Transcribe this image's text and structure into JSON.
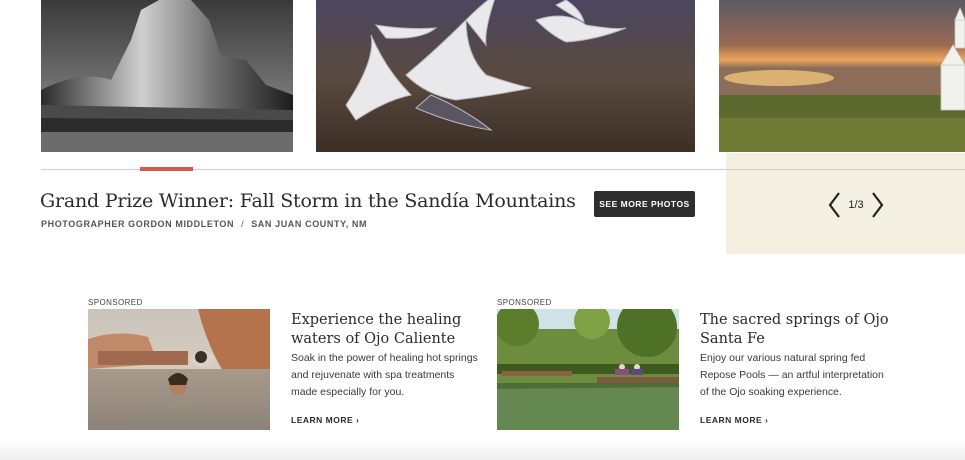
{
  "gallery": {
    "photos": [
      {
        "icon": "black-white-rock-formation-photo"
      },
      {
        "icon": "flying-cranes-photo"
      },
      {
        "icon": "storm-over-prairie-church-photo"
      }
    ],
    "caption_title": "Grand Prize Winner: Fall Storm in the Sandía Mountains",
    "photographer": "PHOTOGRAPHER GORDON MIDDLETON",
    "separator": "/",
    "location": "SAN JUAN COUNTY, NM",
    "see_more_label": "SEE MORE PHOTOS",
    "pager": {
      "current_of_total": "1/3"
    },
    "progress_fraction": 0.333
  },
  "sponsored": [
    {
      "label": "SPONSORED",
      "title": "Experience the healing waters of Ojo Caliente",
      "description": "Soak in the power of healing hot springs and rejuvenate with spa treatments made especially for you.",
      "link": "LEARN MORE ›"
    },
    {
      "label": "SPONSORED",
      "title": "The sacred springs of Ojo Santa Fe",
      "description": "Enjoy our various natural spring fed Repose Pools — an artful interpretation of the Ojo soaking experience.",
      "link": "LEARN MORE ›"
    }
  ],
  "colors": {
    "accent": "#d9584a",
    "button_bg": "#2e2e2e",
    "panel_bg": "#f3f0e2"
  }
}
